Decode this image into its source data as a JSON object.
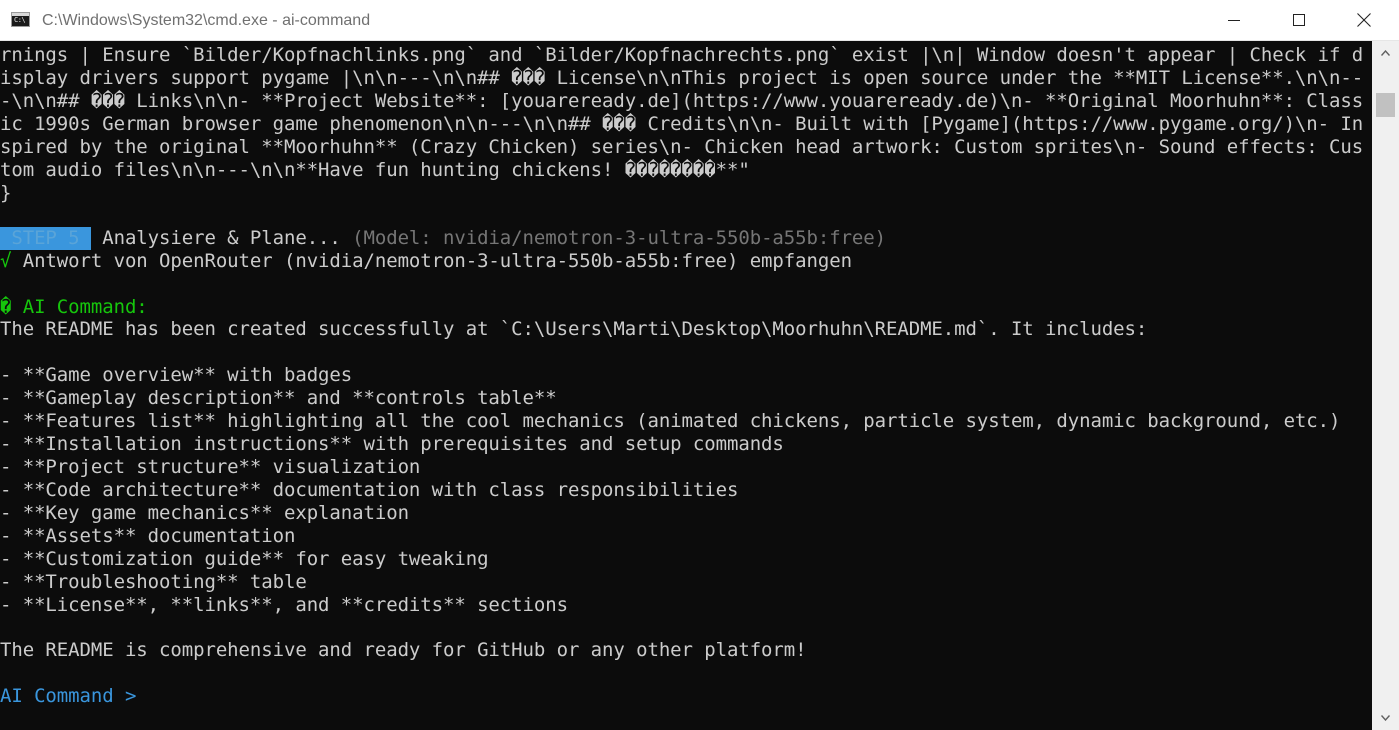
{
  "window": {
    "title": "C:\\Windows\\System32\\cmd.exe - ai-command",
    "icon": "cmd-icon",
    "icon_text": "C:\\"
  },
  "terminal": {
    "lines": [
      "rnings | Ensure `Bilder/Kopfnachlinks.png` and `Bilder/Kopfnachrechts.png` exist |\\n| Window doesn't appear | Check if d",
      "isplay drivers support pygame |\\n\\n---\\n\\n## ��� License\\n\\nThis project is open source under the **MIT License**.\\n\\n--",
      "-\\n\\n## ��� Links\\n\\n- **Project Website**: [youareready.de](https://www.youareready.de)\\n- **Original Moorhuhn**: Class",
      "ic 1990s German browser game phenomenon\\n\\n---\\n\\n## ��� Credits\\n\\n- Built with [Pygame](https://www.pygame.org/)\\n- In",
      "spired by the original **Moorhuhn** (Crazy Chicken) series\\n- Chicken head artwork: Custom sprites\\n- Sound effects: Cus",
      "tom audio files\\n\\n---\\n\\n**Have fun hunting chickens! ��������**\"",
      "}"
    ],
    "step": {
      "badge": " STEP 5 ",
      "label": " Analysiere & Plane...",
      "model": " (Model: nvidia/nemotron-3-ultra-550b-a55b:free)"
    },
    "response": {
      "check": "√",
      "text": " Antwort von OpenRouter (nvidia/nemotron-3-ultra-550b-a55b:free) empfangen"
    },
    "ai_header": "� AI Command:",
    "intro": "The README has been created successfully at `C:\\Users\\Marti\\Desktop\\Moorhuhn\\README.md`. It includes:",
    "bullets": [
      "- **Game overview** with badges",
      "- **Gameplay description** and **controls table**",
      "- **Features list** highlighting all the cool mechanics (animated chickens, particle system, dynamic background, etc.)",
      "- **Installation instructions** with prerequisites and setup commands",
      "- **Project structure** visualization",
      "- **Code architecture** documentation with class responsibilities",
      "- **Key game mechanics** explanation",
      "- **Assets** documentation",
      "- **Customization guide** for easy tweaking",
      "- **Troubleshooting** table",
      "- **License**, **links**, and **credits** sections"
    ],
    "summary": "The README is comprehensive and ready for GitHub or any other platform!",
    "prompt": "AI Command > "
  },
  "colors": {
    "background": "#0c0c0c",
    "text": "#cccccc",
    "accent_cyan": "#3a96dd",
    "success_green": "#16c60c",
    "muted_gray": "#767676"
  }
}
